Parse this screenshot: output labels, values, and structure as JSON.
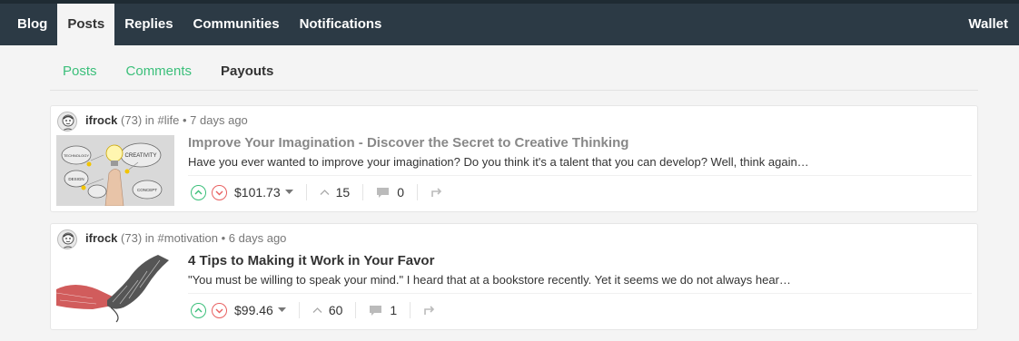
{
  "topnav": {
    "items": [
      "Blog",
      "Posts",
      "Replies",
      "Communities",
      "Notifications"
    ],
    "active": "Posts",
    "wallet": "Wallet"
  },
  "subnav": {
    "items": [
      "Posts",
      "Comments",
      "Payouts"
    ],
    "active": "Payouts"
  },
  "posts": [
    {
      "author": "ifrock",
      "reputation": "(73)",
      "in_word": "in",
      "tag": "#life",
      "age": "• 7 days ago",
      "title": "Improve Your Imagination - Discover the Secret to Creative Thinking",
      "excerpt": "Have you ever wanted to improve your imagination? Do you think it's a talent that you can develop? Well, think again…",
      "payout": "$101.73",
      "votes": "15",
      "comments": "0",
      "thumb_labels": [
        "CREATIVITY",
        "DESIGN",
        "CONCEPT",
        "TECHNOLOGY"
      ]
    },
    {
      "author": "ifrock",
      "reputation": "(73)",
      "in_word": "in",
      "tag": "#motivation",
      "age": "• 6 days ago",
      "title": "4 Tips to Making it Work in Your Favor",
      "excerpt": "\"You must be willing to speak your mind.\" I heard that at a bookstore recently. Yet it seems we do not always hear…",
      "payout": "$99.46",
      "votes": "60",
      "comments": "1"
    }
  ],
  "colors": {
    "topbar": "#2c3a45",
    "accent_green": "#3bbf7a",
    "downvote_red": "#e86060"
  },
  "icons": {
    "upvote": "chevron-up-circle-icon",
    "downvote": "chevron-down-circle-icon",
    "caret": "caret-down-icon",
    "votes": "chevron-up-icon",
    "comments": "comment-bubble-icon",
    "reblog": "reblog-icon"
  }
}
